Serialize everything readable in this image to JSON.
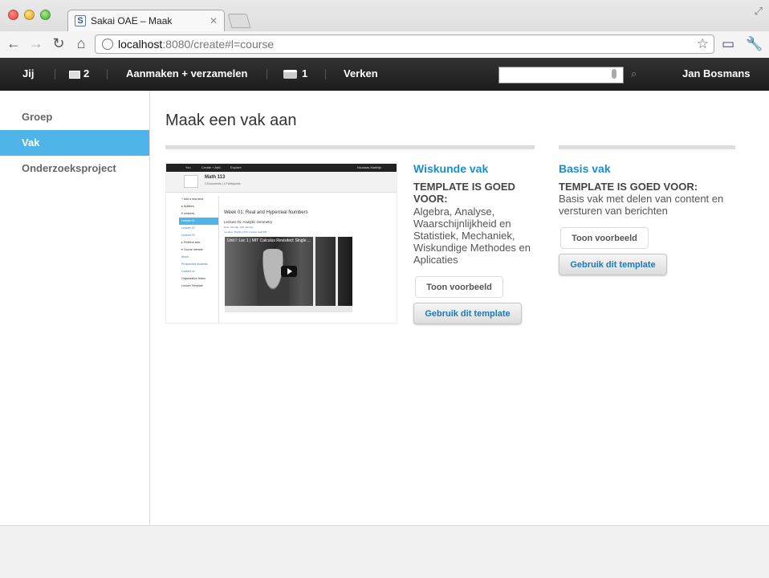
{
  "browser": {
    "tab_title": "Sakai OAE – Maak",
    "tab_favicon": "S",
    "url_host": "localhost",
    "url_rest": ":8080/create#l=course"
  },
  "header": {
    "you": "Jij",
    "messages_count": "2",
    "create": "Aanmaken + verzamelen",
    "inbox_count": "1",
    "explore": "Verken",
    "search_placeholder": "",
    "user": "Jan Bosmans"
  },
  "sidebar": {
    "items": [
      {
        "label": "Groep"
      },
      {
        "label": "Vak"
      },
      {
        "label": "Onderzoeksproject"
      }
    ]
  },
  "main": {
    "title": "Maak een vak aan",
    "templates": [
      {
        "name": "Wiskunde vak",
        "good_for": "TEMPLATE IS GOED VOOR:",
        "description": "Algebra, Analyse, Waarschijnlijkheid en Statistiek, Mechaniek, Wiskundige Methodes en Aplicaties",
        "preview_label": "Toon voorbeeld",
        "use_label": "Gebruik dit template"
      },
      {
        "name": "Basis vak",
        "good_for": "TEMPLATE IS GOED VOOR:",
        "description": "Basis vak met delen van content en versturen van berichten",
        "preview_label": "Toon voorbeeld",
        "use_label": "Gebruik dit template"
      }
    ]
  },
  "thumbnail": {
    "nav": [
      "You",
      "Create + Add",
      "Explore"
    ],
    "user": "Nicolaas Matthijs",
    "course_name": "Math 113",
    "course_sub": "0 Documents | 1 Participants",
    "side_items": [
      "+ Add a new area",
      "▸ Syllabus",
      "▾ Lectures",
      "Lecture 01",
      "Lecture 02",
      "Lecture 03",
      "▸ Problem sets",
      "▾ Course website",
      "About",
      "Prospective students",
      "Contact us",
      "Organization Notes",
      "Lecture Template"
    ],
    "week": "Week 01: Real and Hyperreal Numbers",
    "lecture": "Lecture 01: Analytic Geometry",
    "meta": [
      "Date: Monday 10th January",
      "Location: Building 600, Lecture Hall 308"
    ],
    "video_title": "Unit I: Lec 1 | MIT Calculus Revisited: Single ..."
  },
  "colors": {
    "accent": "#1a8fcf",
    "sidebar_active": "#4fb4e8",
    "header_bg": "#1c1c1c"
  },
  "icons": [
    "back-arrow-icon",
    "forward-arrow-icon",
    "reload-icon",
    "home-icon",
    "globe-icon",
    "star-icon",
    "screen-icon",
    "wrench-icon",
    "envelope-icon",
    "tray-icon",
    "mic-icon",
    "search-icon"
  ]
}
